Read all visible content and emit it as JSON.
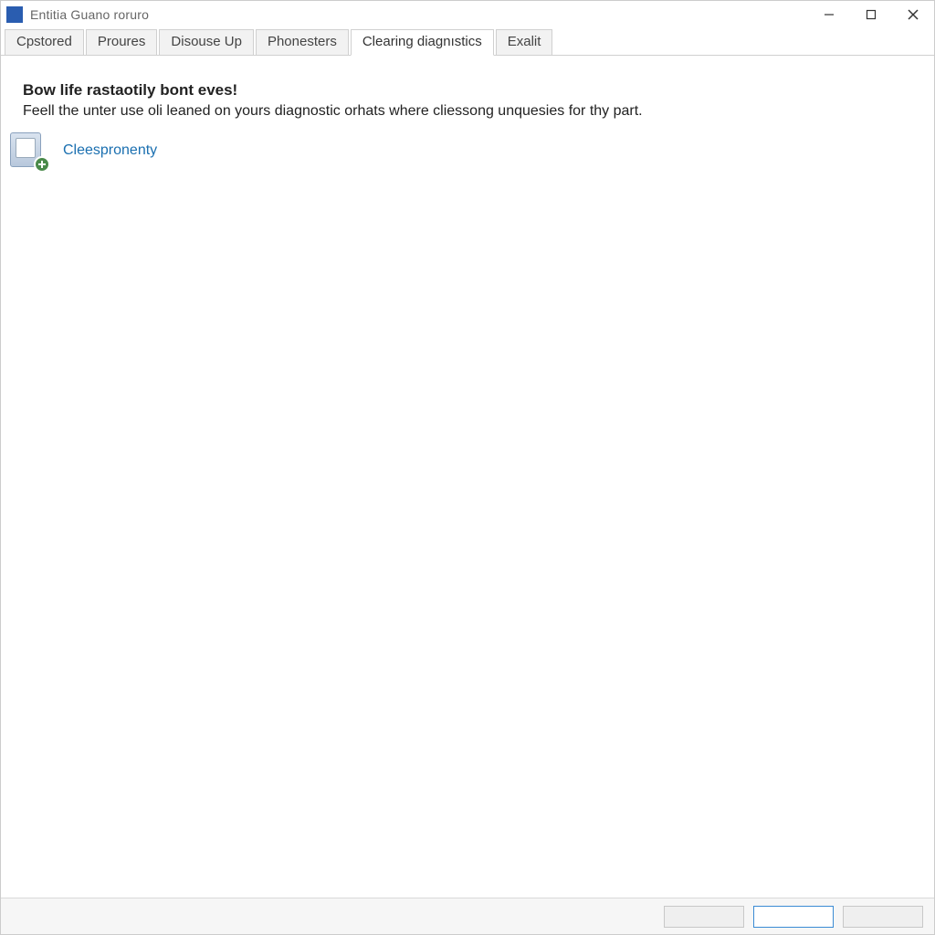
{
  "titlebar": {
    "title": "Entitia Guano roruro"
  },
  "tabs": [
    {
      "label": "Cpstored",
      "active": false
    },
    {
      "label": "Proures",
      "active": false
    },
    {
      "label": "Disouse Up",
      "active": false
    },
    {
      "label": "Phonesters",
      "active": false
    },
    {
      "label": "Clearing diagnıstics",
      "active": true
    },
    {
      "label": "Exalit",
      "active": false
    }
  ],
  "content": {
    "heading": "Bow life rastaotily bont eves!",
    "subtext": "Feell the unter use oli leaned on yours diagnostic orhats where cliessong unquesies for thy part.",
    "link_label": "Cleespronenty"
  },
  "footer": {
    "btn1": "",
    "btn2": "",
    "btn3": ""
  }
}
